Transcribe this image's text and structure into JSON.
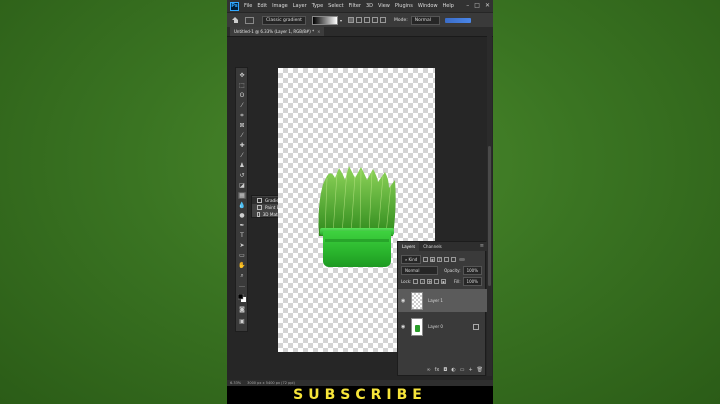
{
  "app": {
    "logo": "Ps",
    "menu": [
      "File",
      "Edit",
      "Image",
      "Layer",
      "Type",
      "Select",
      "Filter",
      "3D",
      "View",
      "Plugins",
      "Window",
      "Help"
    ],
    "window_controls": [
      "–",
      "□",
      "✕"
    ]
  },
  "options_bar": {
    "preset": "Classic gradient",
    "mode_label": "Mode:",
    "mode_value": "Normal"
  },
  "document_tab": {
    "title": "Untitled-1 @ 6.33% (Layer 1, RGB/8#) *",
    "close": "×"
  },
  "flyout": {
    "items": [
      {
        "label": "Gradient Tool",
        "key": "G"
      },
      {
        "label": "Paint Bucket Tool",
        "key": "G"
      },
      {
        "label": "3D Material Drop Tool",
        "key": "G"
      }
    ]
  },
  "layers_panel": {
    "tabs": [
      "Layers",
      "Channels"
    ],
    "kind": "Kind",
    "blend_mode": "Normal",
    "opacity_label": "Opacity:",
    "opacity_value": "100%",
    "lock_label": "Lock:",
    "fill_label": "Fill:",
    "fill_value": "100%",
    "layers": [
      {
        "name": "Layer 1",
        "selected": true
      },
      {
        "name": "Layer 0",
        "selected": false
      }
    ]
  },
  "status_bar": {
    "zoom": "6.33%",
    "doc_info": "3000 px x 5400 px (72 ppi)"
  },
  "overlay": {
    "subscribe": "SUBSCRIBE"
  },
  "colors": {
    "background_green": "#3a7422",
    "subscribe_yellow": "#f7e53a",
    "pot_green": "#29b32c"
  }
}
